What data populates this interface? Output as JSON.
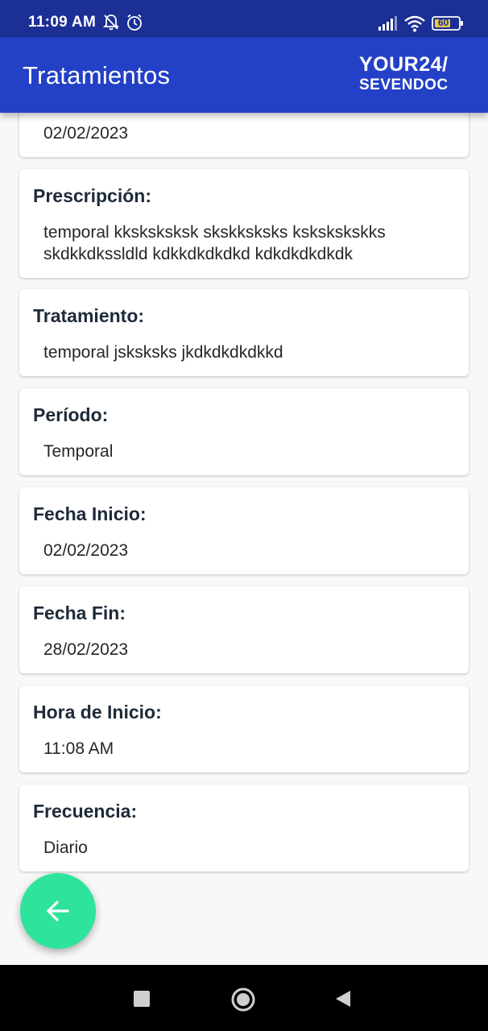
{
  "status_bar": {
    "time": "11:09 AM",
    "battery": "60"
  },
  "app_bar": {
    "title": "Tratamientos",
    "logo_line1": "YOUR24/",
    "logo_line2": "SEVENDOC"
  },
  "cards": {
    "date_top": {
      "value": "02/02/2023"
    },
    "prescription": {
      "label": "Prescripción:",
      "value": "temporal kksksksksk skskksksks kskskskskks skdkkdkssldld kdkkdkdkdkd kdkdkdkdkdk"
    },
    "treatment": {
      "label": "Tratamiento:",
      "value": "temporal jsksksks jkdkdkdkdkkd"
    },
    "period": {
      "label": "Período:",
      "value": "Temporal"
    },
    "start_date": {
      "label": "Fecha Inicio:",
      "value": "02/02/2023"
    },
    "end_date": {
      "label": "Fecha Fin:",
      "value": "28/02/2023"
    },
    "start_time": {
      "label": "Hora de Inicio:",
      "value": "11:08 AM"
    },
    "frequency": {
      "label": "Frecuencia:",
      "value": "Diario"
    }
  },
  "colors": {
    "status_bar": "#1c2f95",
    "app_bar": "#2340c6",
    "fab": "#2ee49c",
    "background": "#f8f8f8"
  },
  "icons": {
    "fab": "arrow-left-icon",
    "nav_recents": "square-icon",
    "nav_home": "circle-icon",
    "nav_back": "triangle-back-icon"
  }
}
